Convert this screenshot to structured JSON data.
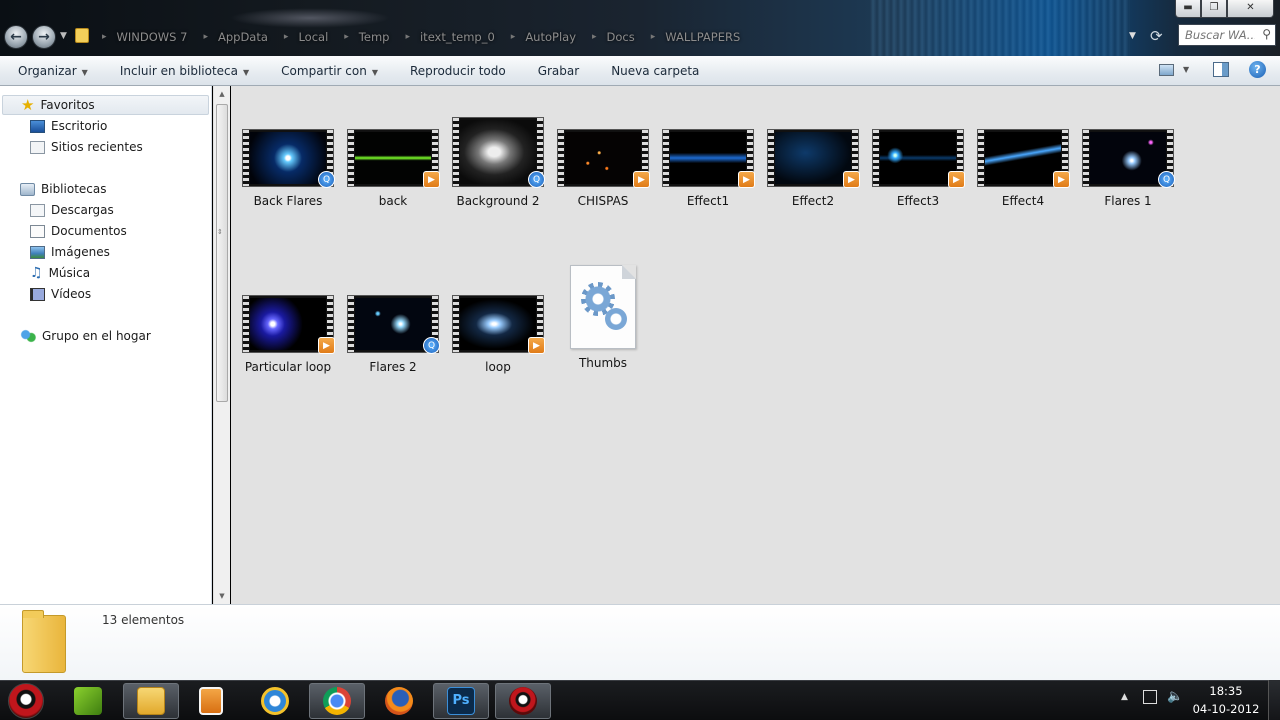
{
  "window": {
    "breadcrumb": [
      "WINDOWS 7",
      "AppData",
      "Local",
      "Temp",
      "itext_temp_0",
      "AutoPlay",
      "Docs",
      "WALLPAPERS"
    ],
    "search_placeholder": "Buscar WA...",
    "controls": {
      "minimize": "▬",
      "maximize": "❐",
      "close": "✕"
    }
  },
  "commandbar": {
    "organize": "Organizar",
    "include_library": "Incluir en biblioteca",
    "share": "Compartir con",
    "play_all": "Reproducir todo",
    "burn": "Grabar",
    "new_folder": "Nueva carpeta"
  },
  "navpane": {
    "favorites": {
      "label": "Favoritos",
      "icon": "star-icon"
    },
    "desktop": {
      "label": "Escritorio",
      "icon": "desktop-icon"
    },
    "recent": {
      "label": "Sitios recientes",
      "icon": "recent-places-icon"
    },
    "libraries": {
      "label": "Bibliotecas",
      "icon": "libraries-icon"
    },
    "downloads": {
      "label": "Descargas",
      "icon": "downloads-icon"
    },
    "documents": {
      "label": "Documentos",
      "icon": "documents-icon"
    },
    "images": {
      "label": "Imágenes",
      "icon": "pictures-icon"
    },
    "music": {
      "label": "Música",
      "icon": "music-icon"
    },
    "videos": {
      "label": "Vídeos",
      "icon": "videos-icon"
    },
    "homegroup": {
      "label": "Grupo en el hogar",
      "icon": "homegroup-icon"
    }
  },
  "files": [
    {
      "name": "Back Flares",
      "type": "video",
      "badge": "quicktime"
    },
    {
      "name": "back",
      "type": "video",
      "badge": "play"
    },
    {
      "name": "Background 2",
      "type": "video",
      "badge": "quicktime"
    },
    {
      "name": "CHISPAS",
      "type": "video",
      "badge": "play"
    },
    {
      "name": "Effect1",
      "type": "video",
      "badge": "play"
    },
    {
      "name": "Effect2",
      "type": "video",
      "badge": "play"
    },
    {
      "name": "Effect3",
      "type": "video",
      "badge": "play"
    },
    {
      "name": "Effect4",
      "type": "video",
      "badge": "play"
    },
    {
      "name": "Flares 1",
      "type": "video",
      "badge": "quicktime"
    },
    {
      "name": "Particular loop",
      "type": "video",
      "badge": "play"
    },
    {
      "name": "Flares 2",
      "type": "video",
      "badge": "quicktime"
    },
    {
      "name": "loop",
      "type": "video",
      "badge": "play"
    },
    {
      "name": "Thumbs",
      "type": "system-file",
      "badge": "gear"
    }
  ],
  "details": {
    "count_text": "13 elementos"
  },
  "taskbar": {
    "apps": [
      "start-orb",
      "nvidia-icon",
      "explorer-icon",
      "media-player-icon",
      "internet-explorer-icon",
      "chrome-icon",
      "firefox-icon",
      "photoshop-icon",
      "app-icon"
    ],
    "photoshop_label": "Ps",
    "time": "18:35",
    "date": "04-10-2012"
  },
  "colors": {
    "accent": "#1a5fb4",
    "content_bg": "#e2e2e2",
    "badge_play": "#e07b18"
  }
}
